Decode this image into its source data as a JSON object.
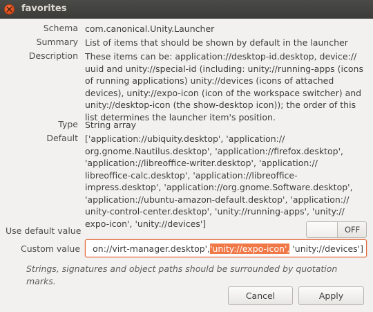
{
  "window": {
    "title": "favorites"
  },
  "fields": {
    "schema": {
      "label": "Schema",
      "value": "com.canonical.Unity.Launcher"
    },
    "summary": {
      "label": "Summary",
      "value": "List of items that should be shown by default in the launcher"
    },
    "description": {
      "label": "Description",
      "value": "These items can be: application://desktop-id.desktop, device:// uuid and unity://special-id (including: unity://running-apps (icons of running applications) unity://devices (icons of attached devices), unity://expo-icon (icon of the workspace switcher) and unity://desktop-icon (the show-desktop icon)); the order of this list determines the launcher item's position."
    },
    "type": {
      "label": "Type",
      "value": "String array"
    },
    "default": {
      "label": "Default",
      "value": "['application://ubiquity.desktop', 'application:// org.gnome.Nautilus.desktop', 'application://firefox.desktop', 'application://libreoffice-writer.desktop', 'application:// libreoffice-calc.desktop', 'application://libreoffice-impress.desktop', 'application://org.gnome.Software.desktop', 'application://ubuntu-amazon-default.desktop', 'application:// unity-control-center.desktop', 'unity://running-apps', 'unity:// expo-icon', 'unity://devices']"
    }
  },
  "use_default": {
    "label": "Use default value",
    "state": "OFF"
  },
  "custom_value": {
    "label": "Custom value",
    "text_before": "on://virt-manager.desktop',",
    "text_selected": "'unity://expo-icon',",
    "text_after": " 'unity://devices']"
  },
  "hint": "Strings, signatures and object paths should be surrounded by quotation marks.",
  "buttons": {
    "cancel": "Cancel",
    "apply": "Apply"
  },
  "colors": {
    "accent": "#f07746",
    "titlebar": "#3c3b37",
    "close": "#df4a16"
  }
}
